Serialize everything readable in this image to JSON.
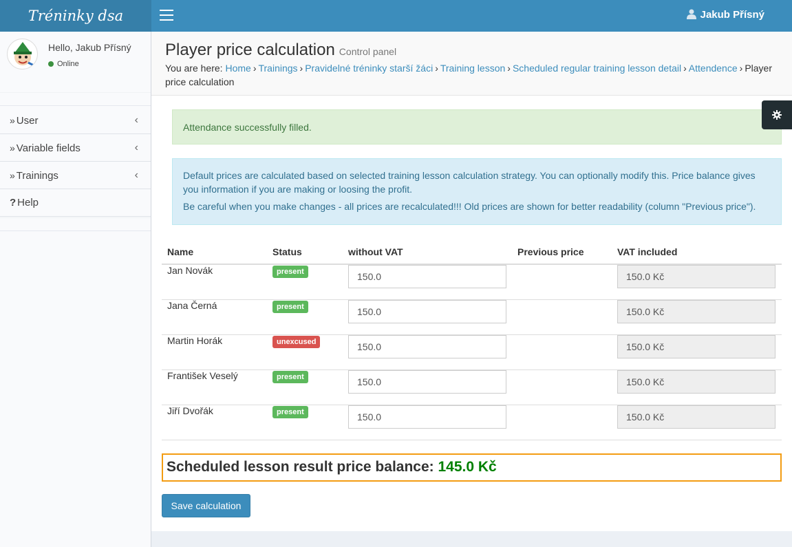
{
  "app": {
    "logo": "Tréninky dsa",
    "user_name": "Jakub Přísný"
  },
  "sidebar": {
    "hello": "Hello, Jakub Přísný",
    "status": "Online",
    "items": [
      {
        "label": "User",
        "icon": "raquo"
      },
      {
        "label": "Variable fields",
        "icon": "raquo"
      },
      {
        "label": "Trainings",
        "icon": "raquo"
      },
      {
        "label": "Help",
        "icon": "question"
      }
    ]
  },
  "page": {
    "title": "Player price calculation",
    "subtitle": "Control panel",
    "breadcrumb_prefix": "You are here:",
    "breadcrumb": [
      "Home",
      "Trainings",
      "Pravidelné tréninky starší žáci",
      "Training lesson",
      "Scheduled regular training lesson detail",
      "Attendence"
    ],
    "breadcrumb_current": "Player price calculation"
  },
  "alerts": {
    "success": "Attendance successfully filled.",
    "info_1": "Default prices are calculated based on selected training lesson calculation strategy. You can optionally modify this. Price balance gives you information if you are making or loosing the profit.",
    "info_2": "Be careful when you make changes - all prices are recalculated!!! Old prices are shown for better readability (column \"Previous price\")."
  },
  "table": {
    "headers": {
      "name": "Name",
      "status": "Status",
      "without_vat": "without VAT",
      "previous": "Previous price",
      "vat_included": "VAT included"
    },
    "rows": [
      {
        "name": "Jan Novák",
        "status": "present",
        "status_color": "#5cb85c",
        "without_vat": "150.0",
        "previous": "",
        "vat_included": "150.0 Kč"
      },
      {
        "name": "Jana Černá",
        "status": "present",
        "status_color": "#5cb85c",
        "without_vat": "150.0",
        "previous": "",
        "vat_included": "150.0 Kč"
      },
      {
        "name": "Martin Horák",
        "status": "unexcused",
        "status_color": "#d9534f",
        "without_vat": "150.0",
        "previous": "",
        "vat_included": "150.0 Kč"
      },
      {
        "name": "František Veselý",
        "status": "present",
        "status_color": "#5cb85c",
        "without_vat": "150.0",
        "previous": "",
        "vat_included": "150.0 Kč"
      },
      {
        "name": "Jiří Dvořák",
        "status": "present",
        "status_color": "#5cb85c",
        "without_vat": "150.0",
        "previous": "",
        "vat_included": "150.0 Kč"
      }
    ]
  },
  "balance": {
    "label": "Scheduled lesson result price balance:",
    "value": "145.0 Kč",
    "value_color": "#008000"
  },
  "actions": {
    "save": "Save calculation"
  },
  "colors": {
    "header": "#3c8dbc",
    "logo_bg": "#367fa9",
    "accent_border": "#f39c12"
  }
}
